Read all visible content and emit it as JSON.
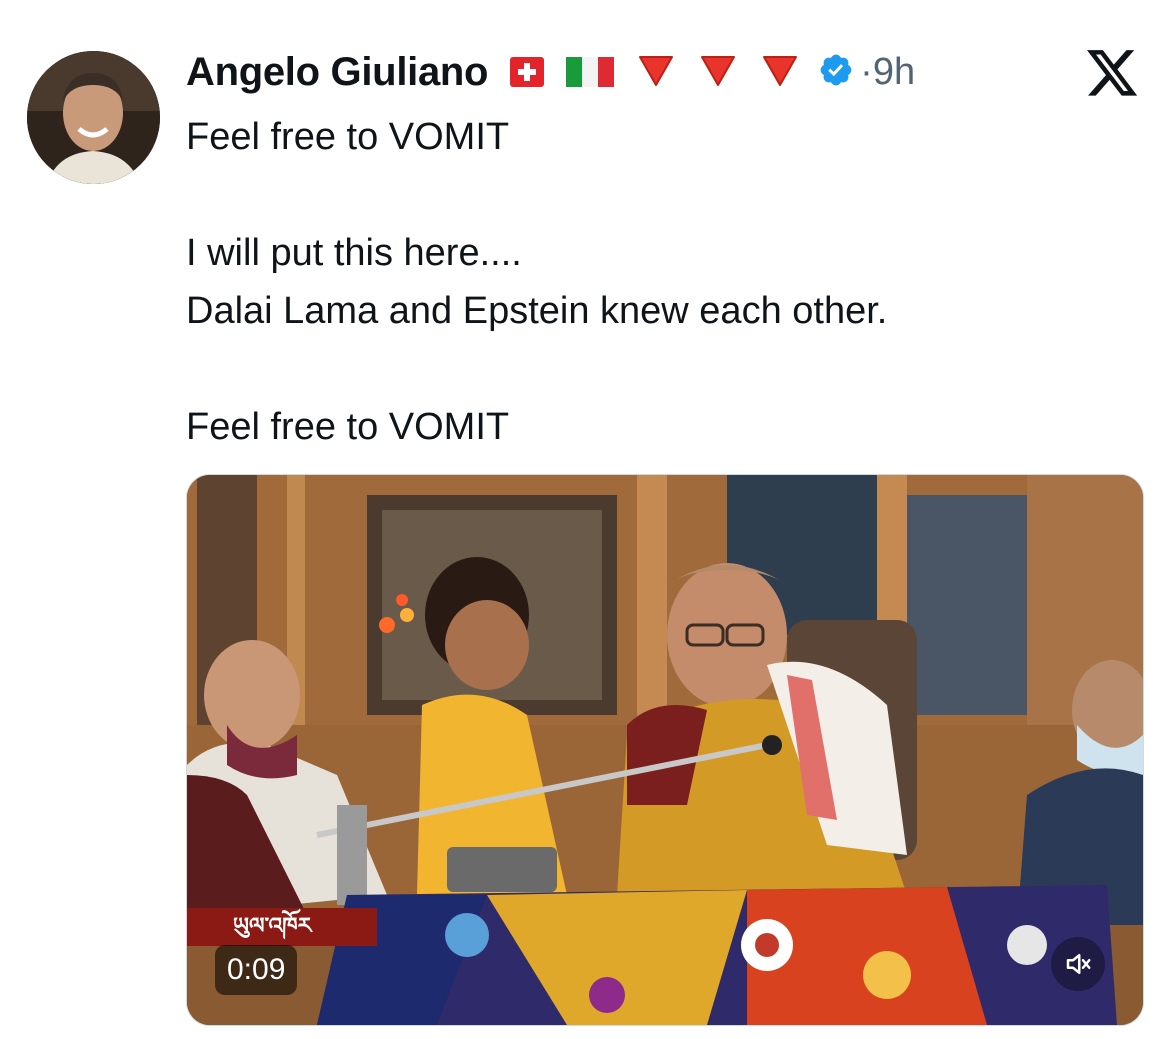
{
  "author": {
    "name": "Angelo Giuliano",
    "emoji_badges": [
      "swiss-flag",
      "italian-flag",
      "red-down-triangle",
      "red-down-triangle",
      "red-down-triangle"
    ],
    "verified": true
  },
  "meta": {
    "separator": "·",
    "time": "9h"
  },
  "tweet": {
    "line1": "Feel free to VOMIT",
    "line2": "I will put this here....",
    "line3": "Dalai Lama and Epstein knew each other.",
    "line4": "Feel free to VOMIT"
  },
  "video": {
    "channel_label": "ཡུལ་འཁོར",
    "timestamp": "0:09",
    "muted": true
  },
  "colors": {
    "text": "#0f1419",
    "secondary": "#536471",
    "verified_blue": "#1d9bf0",
    "badge_red": "#8c1a14"
  },
  "icons": {
    "close": "x-logo-icon",
    "verified": "verified-badge-icon",
    "mute": "speaker-muted-icon"
  }
}
